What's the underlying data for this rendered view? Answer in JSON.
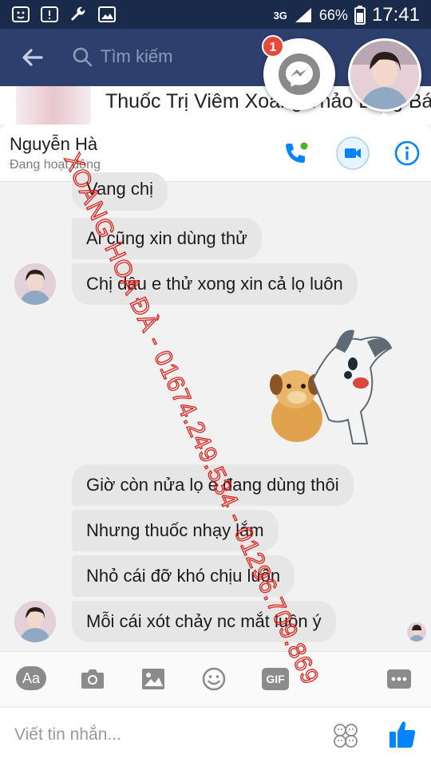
{
  "status_bar": {
    "network": "3G",
    "battery": "66%",
    "time": "17:41"
  },
  "app_bar": {
    "search_placeholder": "Tìm kiếm"
  },
  "background_post": {
    "title": "Thuốc Trị Viêm Xoang Thảo Lang Bát"
  },
  "chat_heads": {
    "messenger_badge": "1"
  },
  "chat_header": {
    "contact_name": "Nguyễn Hà",
    "status": "Đang hoạt động"
  },
  "messages": [
    {
      "text": "Vang chị"
    },
    {
      "text": "Ai cũng xin dùng thử"
    },
    {
      "text": "Chị dâu e thử xong xin cả lọ luôn"
    },
    {
      "text": "Giờ còn nửa lọ e đang dùng thôi"
    },
    {
      "text": "Nhưng thuốc nhạy lắm"
    },
    {
      "text": "Nhỏ cái đỡ khó chịu luôn"
    },
    {
      "text": "Mỗi cái xót chảy nc mắt luôn ý"
    }
  ],
  "toolbar": {
    "text_label": "Aa",
    "gif_label": "GIF"
  },
  "composer": {
    "placeholder": "Viết tin nhắn..."
  },
  "watermark": {
    "text": "XOANG HOA ĐÀ - 01674.249.534 - 01296.709.869"
  },
  "colors": {
    "messenger_blue": "#0084ff",
    "header_navy": "#2d3f6c",
    "watermark_red": "#e0211a",
    "bubble_gray": "#e6e6e6"
  }
}
